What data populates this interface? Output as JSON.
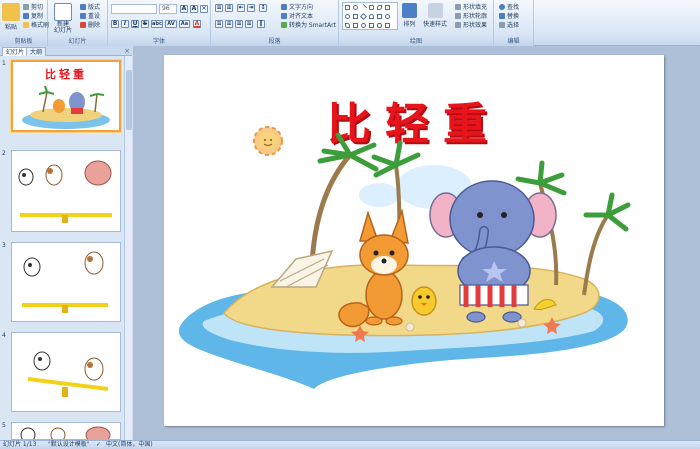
{
  "ribbon": {
    "clipboard": {
      "label": "剪贴板",
      "paste": "粘贴",
      "cut": "剪切",
      "copy": "复制",
      "format_painter": "格式刷"
    },
    "slides": {
      "label": "幻灯片",
      "new_slide": "新建\n幻灯片",
      "layout": "版式",
      "reset": "重设",
      "delete": "删除"
    },
    "font": {
      "label": "字体",
      "font_size": "96",
      "bold": "B",
      "italic": "I",
      "underline": "U",
      "strike": "S",
      "shadow": "abc",
      "spacing": "AV",
      "case": "Aa",
      "color": "A"
    },
    "paragraph": {
      "label": "段落",
      "text_direction": "文字方向",
      "align_text": "对齐文本",
      "convert_smartart": "转换为 SmartArt"
    },
    "drawing": {
      "label": "绘图",
      "arrange": "排列",
      "quick_styles": "快速样式",
      "shape_fill": "形状填充",
      "shape_outline": "形状轮廓",
      "shape_effects": "形状效果"
    },
    "editing": {
      "label": "编辑",
      "find": "查找",
      "replace": "替换",
      "select": "选择"
    }
  },
  "left_pane": {
    "tabs": [
      "幻灯片",
      "大纲"
    ],
    "close": "×",
    "slides": [
      {
        "number": "1",
        "title": "比轻重"
      },
      {
        "number": "2"
      },
      {
        "number": "3"
      },
      {
        "number": "4"
      },
      {
        "number": "5"
      }
    ]
  },
  "slide": {
    "title": "比轻重"
  },
  "status_bar": {
    "slide_counter": "幻灯片 1/13",
    "theme": "\"默认设计模板\"",
    "language": "中文(简体，中国)"
  },
  "colors": {
    "title_red": "#e8141b",
    "ribbon_bg": "#dbe7f6",
    "workspace": "#aebfd8",
    "active_border": "#f2a33b"
  }
}
